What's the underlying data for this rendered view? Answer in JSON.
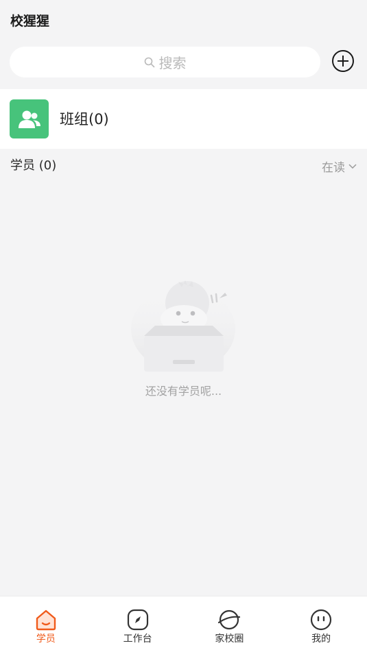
{
  "header": {
    "title": "校猩猩"
  },
  "search": {
    "placeholder": "搜索",
    "icon": "search-icon"
  },
  "add_button": {
    "icon": "plus-circle-icon"
  },
  "group": {
    "label": "班组",
    "count": "(0)",
    "icon": "group-users-icon",
    "color": "#47c37b"
  },
  "students": {
    "title": "学员 (0)",
    "filter_label": "在读",
    "filter_icon": "chevron-down-icon"
  },
  "empty_state": {
    "message": "还没有学员呢...",
    "illustration": "empty-box-monkey-illustration"
  },
  "tabs": [
    {
      "label": "学员",
      "icon": "home-icon",
      "active": true
    },
    {
      "label": "工作台",
      "icon": "compass-icon",
      "active": false
    },
    {
      "label": "家校圈",
      "icon": "planet-icon",
      "active": false
    },
    {
      "label": "我的",
      "icon": "face-icon",
      "active": false
    }
  ],
  "colors": {
    "accent": "#f05a1a",
    "background": "#f4f4f5"
  }
}
